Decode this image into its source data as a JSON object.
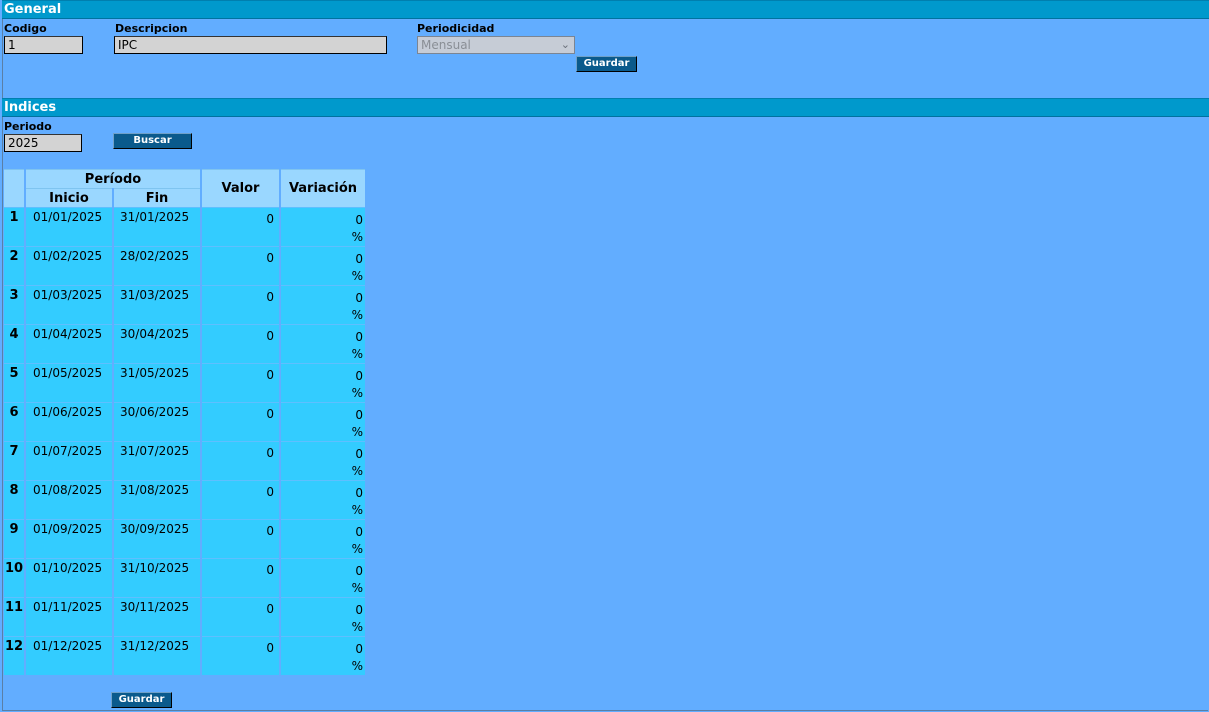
{
  "general": {
    "title": "General",
    "codigo_label": "Codigo",
    "codigo_value": "1",
    "descripcion_label": "Descripcion",
    "descripcion_value": "IPC",
    "periodicidad_label": "Periodicidad",
    "periodicidad_value": "Mensual",
    "save_label": "Guardar"
  },
  "indices": {
    "title": "Indices",
    "periodo_label": "Periodo",
    "periodo_value": "2025",
    "search_label": "Buscar",
    "save_label": "Guardar",
    "table": {
      "header_periodo": "Período",
      "header_inicio": "Inicio",
      "header_fin": "Fin",
      "header_valor": "Valor",
      "header_variacion": "Variación",
      "percent_sign": "%",
      "rows": [
        {
          "n": "1",
          "inicio": "01/01/2025",
          "fin": "31/01/2025",
          "valor": "0",
          "variacion": "0"
        },
        {
          "n": "2",
          "inicio": "01/02/2025",
          "fin": "28/02/2025",
          "valor": "0",
          "variacion": "0"
        },
        {
          "n": "3",
          "inicio": "01/03/2025",
          "fin": "31/03/2025",
          "valor": "0",
          "variacion": "0"
        },
        {
          "n": "4",
          "inicio": "01/04/2025",
          "fin": "30/04/2025",
          "valor": "0",
          "variacion": "0"
        },
        {
          "n": "5",
          "inicio": "01/05/2025",
          "fin": "31/05/2025",
          "valor": "0",
          "variacion": "0"
        },
        {
          "n": "6",
          "inicio": "01/06/2025",
          "fin": "30/06/2025",
          "valor": "0",
          "variacion": "0"
        },
        {
          "n": "7",
          "inicio": "01/07/2025",
          "fin": "31/07/2025",
          "valor": "0",
          "variacion": "0"
        },
        {
          "n": "8",
          "inicio": "01/08/2025",
          "fin": "31/08/2025",
          "valor": "0",
          "variacion": "0"
        },
        {
          "n": "9",
          "inicio": "01/09/2025",
          "fin": "30/09/2025",
          "valor": "0",
          "variacion": "0"
        },
        {
          "n": "10",
          "inicio": "01/10/2025",
          "fin": "31/10/2025",
          "valor": "0",
          "variacion": "0"
        },
        {
          "n": "11",
          "inicio": "01/11/2025",
          "fin": "30/11/2025",
          "valor": "0",
          "variacion": "0"
        },
        {
          "n": "12",
          "inicio": "01/12/2025",
          "fin": "31/12/2025",
          "valor": "0",
          "variacion": "0"
        }
      ]
    }
  }
}
